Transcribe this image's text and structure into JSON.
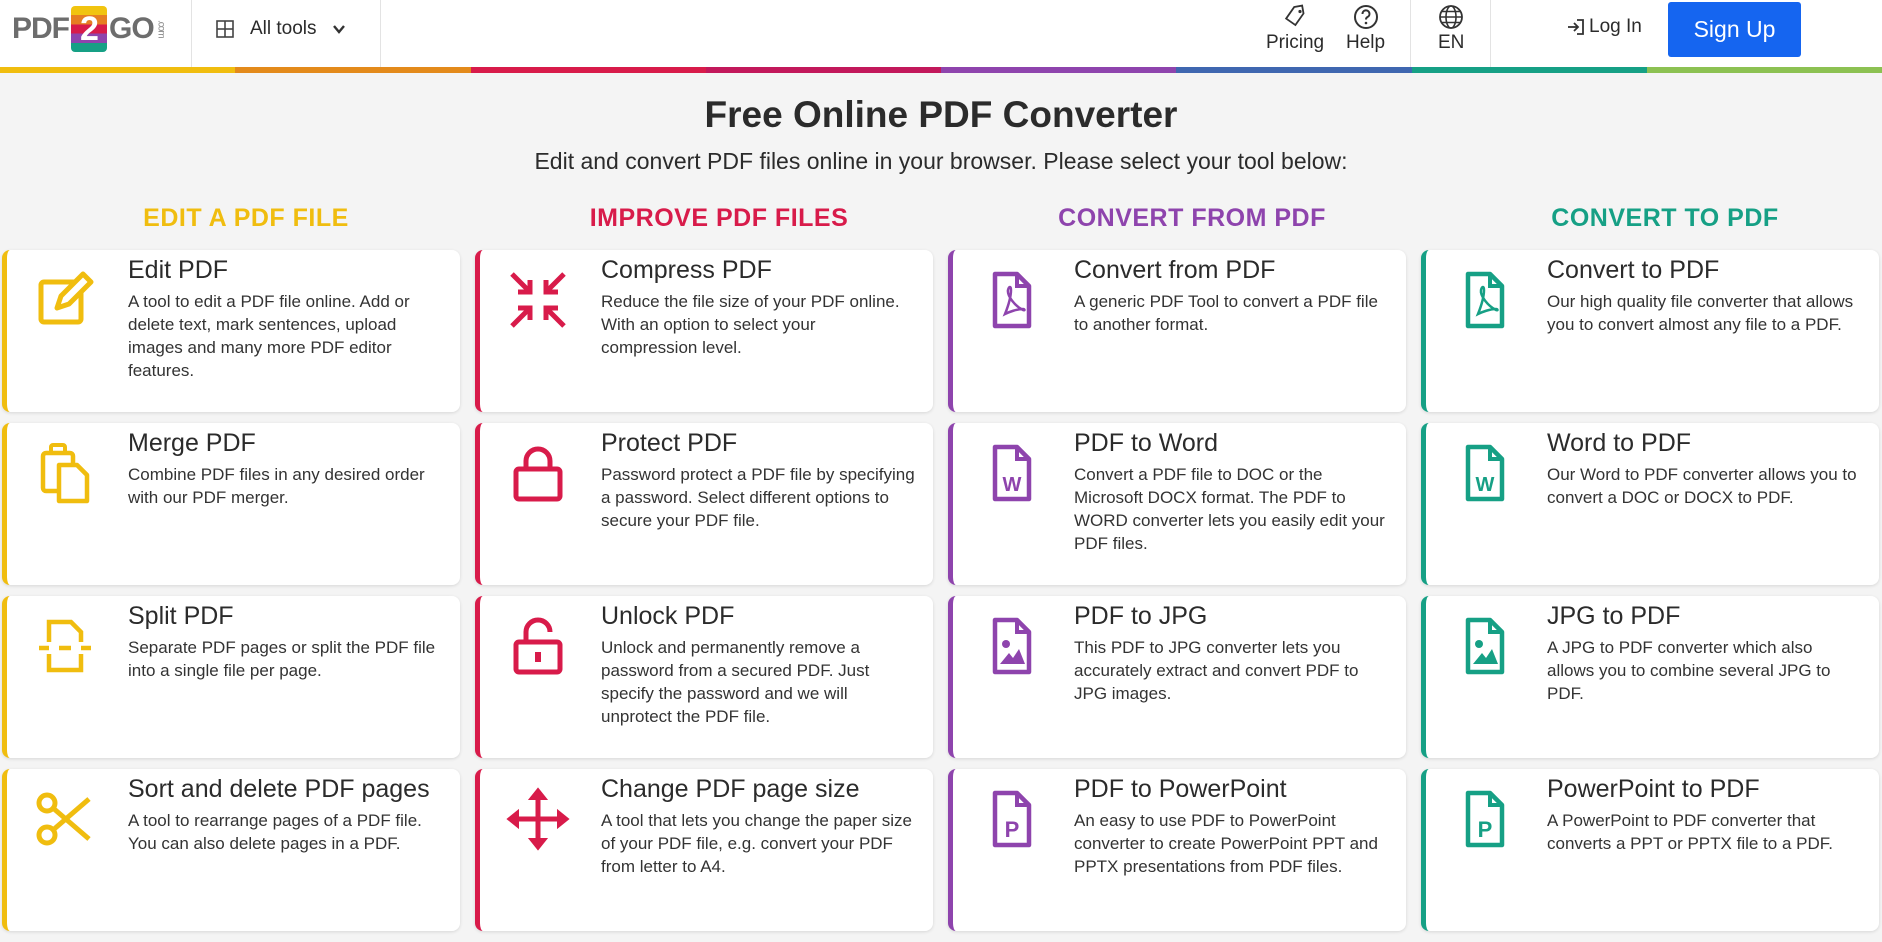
{
  "header": {
    "logo": {
      "pdf": "PDF",
      "two": "2",
      "go": "GO",
      "com": ".com"
    },
    "all_tools": "All tools",
    "pricing": "Pricing",
    "help": "Help",
    "language": "EN",
    "login": "Log In",
    "signup": "Sign Up"
  },
  "colors": {
    "edit": "#f0bd0f",
    "improve": "#d81b4a",
    "convert_from": "#8e44ad",
    "convert_to": "#16a085",
    "primary": "#1565f0"
  },
  "main": {
    "title": "Free Online PDF Converter",
    "subtitle": "Edit and convert PDF files online in your browser. Please select your tool below:"
  },
  "columns": [
    {
      "heading": "EDIT A PDF FILE",
      "cards": [
        {
          "title": "Edit PDF",
          "desc": "A tool to edit a PDF file online. Add or delete text, mark sentences, upload images and many more PDF editor features.",
          "icon": "edit-icon"
        },
        {
          "title": "Merge PDF",
          "desc": "Combine PDF files in any desired order with our PDF merger.",
          "icon": "merge-icon"
        },
        {
          "title": "Split PDF",
          "desc": "Separate PDF pages or split the PDF file into a single file per page.",
          "icon": "split-icon"
        },
        {
          "title": "Sort and delete PDF pages",
          "desc": "A tool to rearrange pages of a PDF file. You can also delete pages in a PDF.",
          "icon": "scissors-icon"
        }
      ]
    },
    {
      "heading": "IMPROVE PDF FILES",
      "cards": [
        {
          "title": "Compress PDF",
          "desc": "Reduce the file size of your PDF online. With an option to select your compression level.",
          "icon": "compress-icon"
        },
        {
          "title": "Protect PDF",
          "desc": "Password protect a PDF file by specifying a password. Select different options to secure your PDF file.",
          "icon": "lock-icon"
        },
        {
          "title": "Unlock PDF",
          "desc": "Unlock and permanently remove a password from a secured PDF. Just specify the password and we will unprotect the PDF file.",
          "icon": "unlock-icon"
        },
        {
          "title": "Change PDF page size",
          "desc": "A tool that lets you change the paper size of your PDF file, e.g. convert your PDF from letter to A4.",
          "icon": "move-icon"
        }
      ]
    },
    {
      "heading": "CONVERT FROM PDF",
      "cards": [
        {
          "title": "Convert from PDF",
          "desc": "A generic PDF Tool to convert a PDF file to another format.",
          "icon": "pdf-file-icon"
        },
        {
          "title": "PDF to Word",
          "desc": "Convert a PDF file to DOC or the Microsoft DOCX format. The PDF to WORD converter lets you easily edit your PDF files.",
          "icon": "word-file-icon"
        },
        {
          "title": "PDF to JPG",
          "desc": "This PDF to JPG converter lets you accurately extract and convert PDF to JPG images.",
          "icon": "image-file-icon"
        },
        {
          "title": "PDF to PowerPoint",
          "desc": "An easy to use PDF to PowerPoint converter to create PowerPoint PPT and PPTX presentations from PDF files.",
          "icon": "powerpoint-file-icon"
        }
      ]
    },
    {
      "heading": "CONVERT TO PDF",
      "cards": [
        {
          "title": "Convert to PDF",
          "desc": "Our high quality file converter that allows you to convert almost any file to a PDF.",
          "icon": "pdf-file-icon"
        },
        {
          "title": "Word to PDF",
          "desc": "Our Word to PDF converter allows you to convert a DOC or DOCX to PDF.",
          "icon": "word-file-icon"
        },
        {
          "title": "JPG to PDF",
          "desc": "A JPG to PDF converter which also allows you to combine several JPG to PDF.",
          "icon": "image-file-icon"
        },
        {
          "title": "PowerPoint to PDF",
          "desc": "A PowerPoint to PDF converter that converts a PPT or PPTX file to a PDF.",
          "icon": "powerpoint-file-icon"
        }
      ]
    }
  ]
}
